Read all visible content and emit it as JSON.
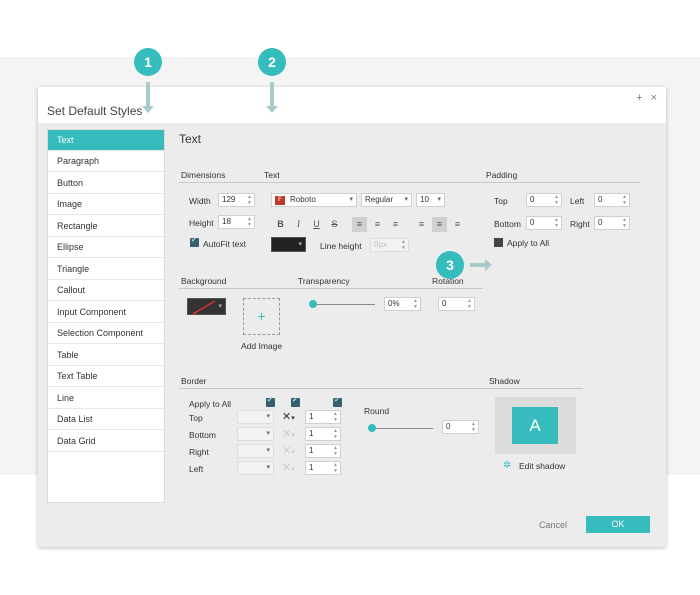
{
  "dialog": {
    "title": "Set Default Styles",
    "add_label": "+",
    "close_label": "×",
    "cancel_label": "Cancel",
    "ok_label": "OK",
    "accent_color": "#36bcbd"
  },
  "sidebar": {
    "items": [
      {
        "label": "Text",
        "active": true
      },
      {
        "label": "Paragraph"
      },
      {
        "label": "Button"
      },
      {
        "label": "Image"
      },
      {
        "label": "Rectangle"
      },
      {
        "label": "Ellipse"
      },
      {
        "label": "Triangle"
      },
      {
        "label": "Callout"
      },
      {
        "label": "Input Component"
      },
      {
        "label": "Selection Component"
      },
      {
        "label": "Table"
      },
      {
        "label": "Text Table"
      },
      {
        "label": "Line"
      },
      {
        "label": "Data List"
      },
      {
        "label": "Data Grid"
      }
    ]
  },
  "main": {
    "title": "Text",
    "dimensions": {
      "heading": "Dimensions",
      "width_label": "Width",
      "width_value": "129",
      "height_label": "Height",
      "height_value": "18",
      "autofit_label": "AutoFit text"
    },
    "text": {
      "heading": "Text",
      "font": "Roboto",
      "weight": "Regular",
      "size": "10",
      "bold": "B",
      "italic": "I",
      "underline": "U",
      "strike": "S",
      "line_height_label": "Line height",
      "line_height_value": "0px",
      "text_color": "#222222"
    },
    "padding": {
      "heading": "Padding",
      "top_label": "Top",
      "top_value": "0",
      "left_label": "Left",
      "left_value": "0",
      "bottom_label": "Bottom",
      "bottom_value": "0",
      "right_label": "Right",
      "right_value": "0",
      "apply_all_label": "Apply to All"
    },
    "background": {
      "heading": "Background",
      "add_image_label": "Add Image",
      "add_image_plus": "+"
    },
    "transparency": {
      "heading": "Transparency",
      "value": "0%",
      "level": 0
    },
    "rotation": {
      "heading": "Rotation",
      "value": "0"
    },
    "border": {
      "heading": "Border",
      "apply_all_label": "Apply to All",
      "rows": [
        {
          "label": "Top",
          "value": "1"
        },
        {
          "label": "Bottom",
          "value": "1"
        },
        {
          "label": "Right",
          "value": "1"
        },
        {
          "label": "Left",
          "value": "1"
        }
      ],
      "round_label": "Round",
      "round_value": "0",
      "round_level": 0
    },
    "shadow": {
      "heading": "Shadow",
      "preview_letter": "A",
      "edit_label": "Edit shadow"
    }
  },
  "callouts": {
    "one": "1",
    "two": "2",
    "three": "3"
  }
}
